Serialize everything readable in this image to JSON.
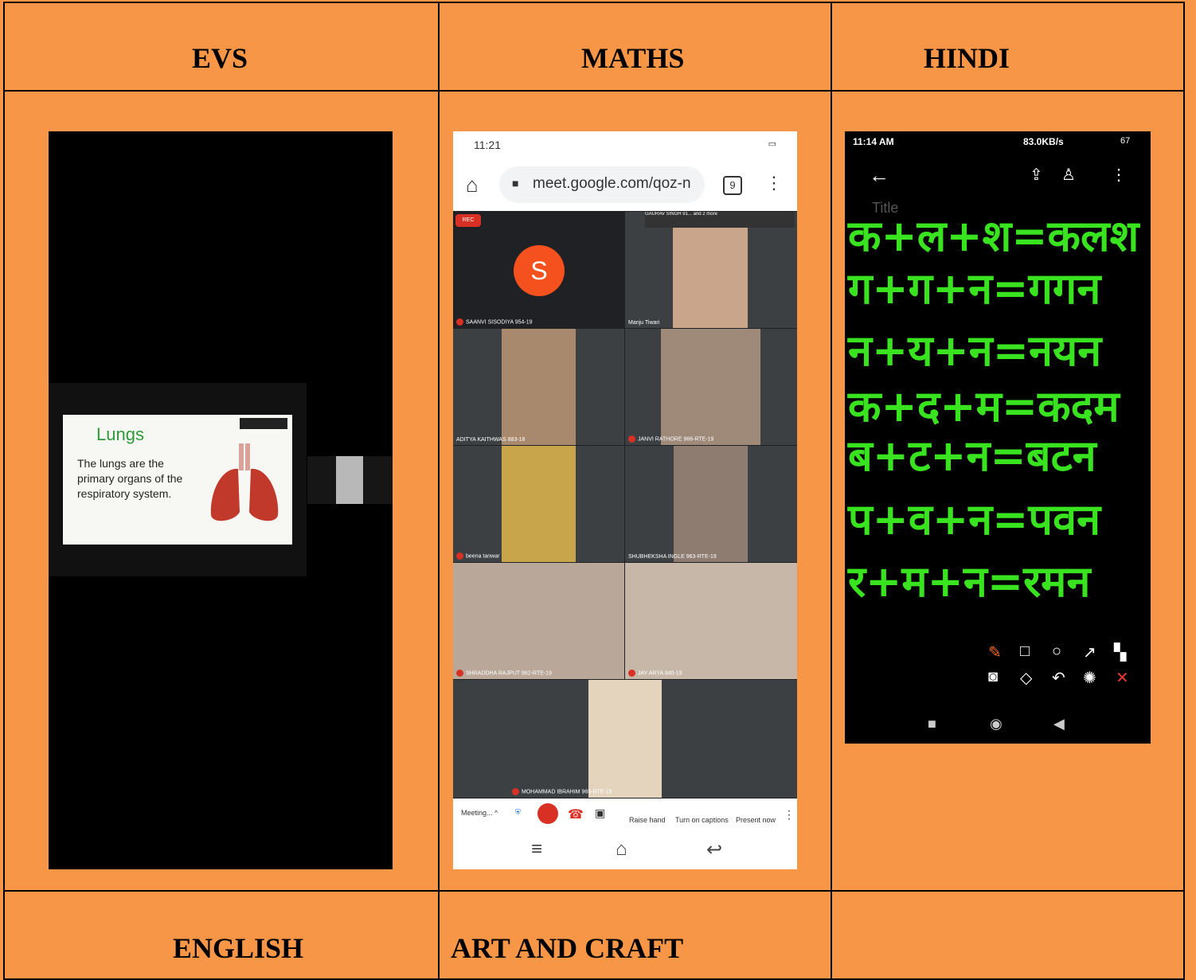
{
  "headers": {
    "evs": "EVS",
    "maths": "MATHS",
    "hindi": "HINDI",
    "english": "ENGLISH",
    "art": "ART AND CRAFT",
    "empty": ""
  },
  "evs": {
    "slide_title": "Lungs",
    "slide_text": "The lungs are the primary organs of the respiratory system."
  },
  "maths": {
    "time": "11:21",
    "url": "meet.google.com/qoz-n",
    "tab_count": "9",
    "rec": "REC",
    "top_info": "GAURAV SINGH 91... and 2 more",
    "avatar_letter": "S",
    "participants": [
      "SAANVI SISODIYA 954-19",
      "Manju Tiwari",
      "ADITYA KAITHWAS 883-18",
      "JANVI RATHORE 966-RTE-19",
      "beena tanwar",
      "SHUBHEKSHA INGLE 963-RTE-19",
      "SHRADDHA RAJPUT 962-RTE-19",
      "JAY ARYA 940-19",
      "MOHAMMAD IBRAHIM 965-RTE-19"
    ],
    "controls": {
      "meeting": "Meeting... ^",
      "raise_hand": "Raise hand",
      "captions": "Turn on captions",
      "present": "Present now"
    }
  },
  "hindi": {
    "time": "11:14 AM",
    "network": "83.0KB/s",
    "battery": "67",
    "title_placeholder": "Title",
    "lines": [
      "क+ल+श=कलश",
      "ग+ग+न=गगन",
      "न+य+न=नयन",
      "क+द+म=कदम",
      "ब+ट+न=बटन",
      "प+व+न=पवन",
      "र+म+न=रमन"
    ]
  },
  "colors": {
    "cell_background": "#f79646",
    "handwriting": "#39e31f",
    "meet_red": "#d93025"
  }
}
